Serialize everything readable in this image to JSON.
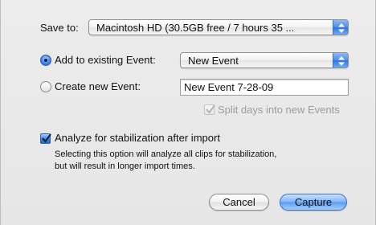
{
  "save_to": {
    "label": "Save to:",
    "value": "Macintosh HD (30.5GB free / 7 hours 35 ..."
  },
  "add_existing": {
    "label": "Add to existing Event:",
    "selected": true,
    "value": "New Event"
  },
  "create_new": {
    "label": "Create new Event:",
    "selected": false,
    "value": "New Event 7-28-09"
  },
  "split_days": {
    "label": "Split days into new Events",
    "checked": true,
    "enabled": false
  },
  "stabilization": {
    "label": "Analyze for stabilization after import",
    "checked": true,
    "description_line1": "Selecting this option will analyze all clips for stabilization,",
    "description_line2": "but will result in longer import times."
  },
  "buttons": {
    "cancel": "Cancel",
    "capture": "Capture"
  },
  "colors": {
    "accent": "#3c84e6",
    "background": "#e8e8e8"
  }
}
